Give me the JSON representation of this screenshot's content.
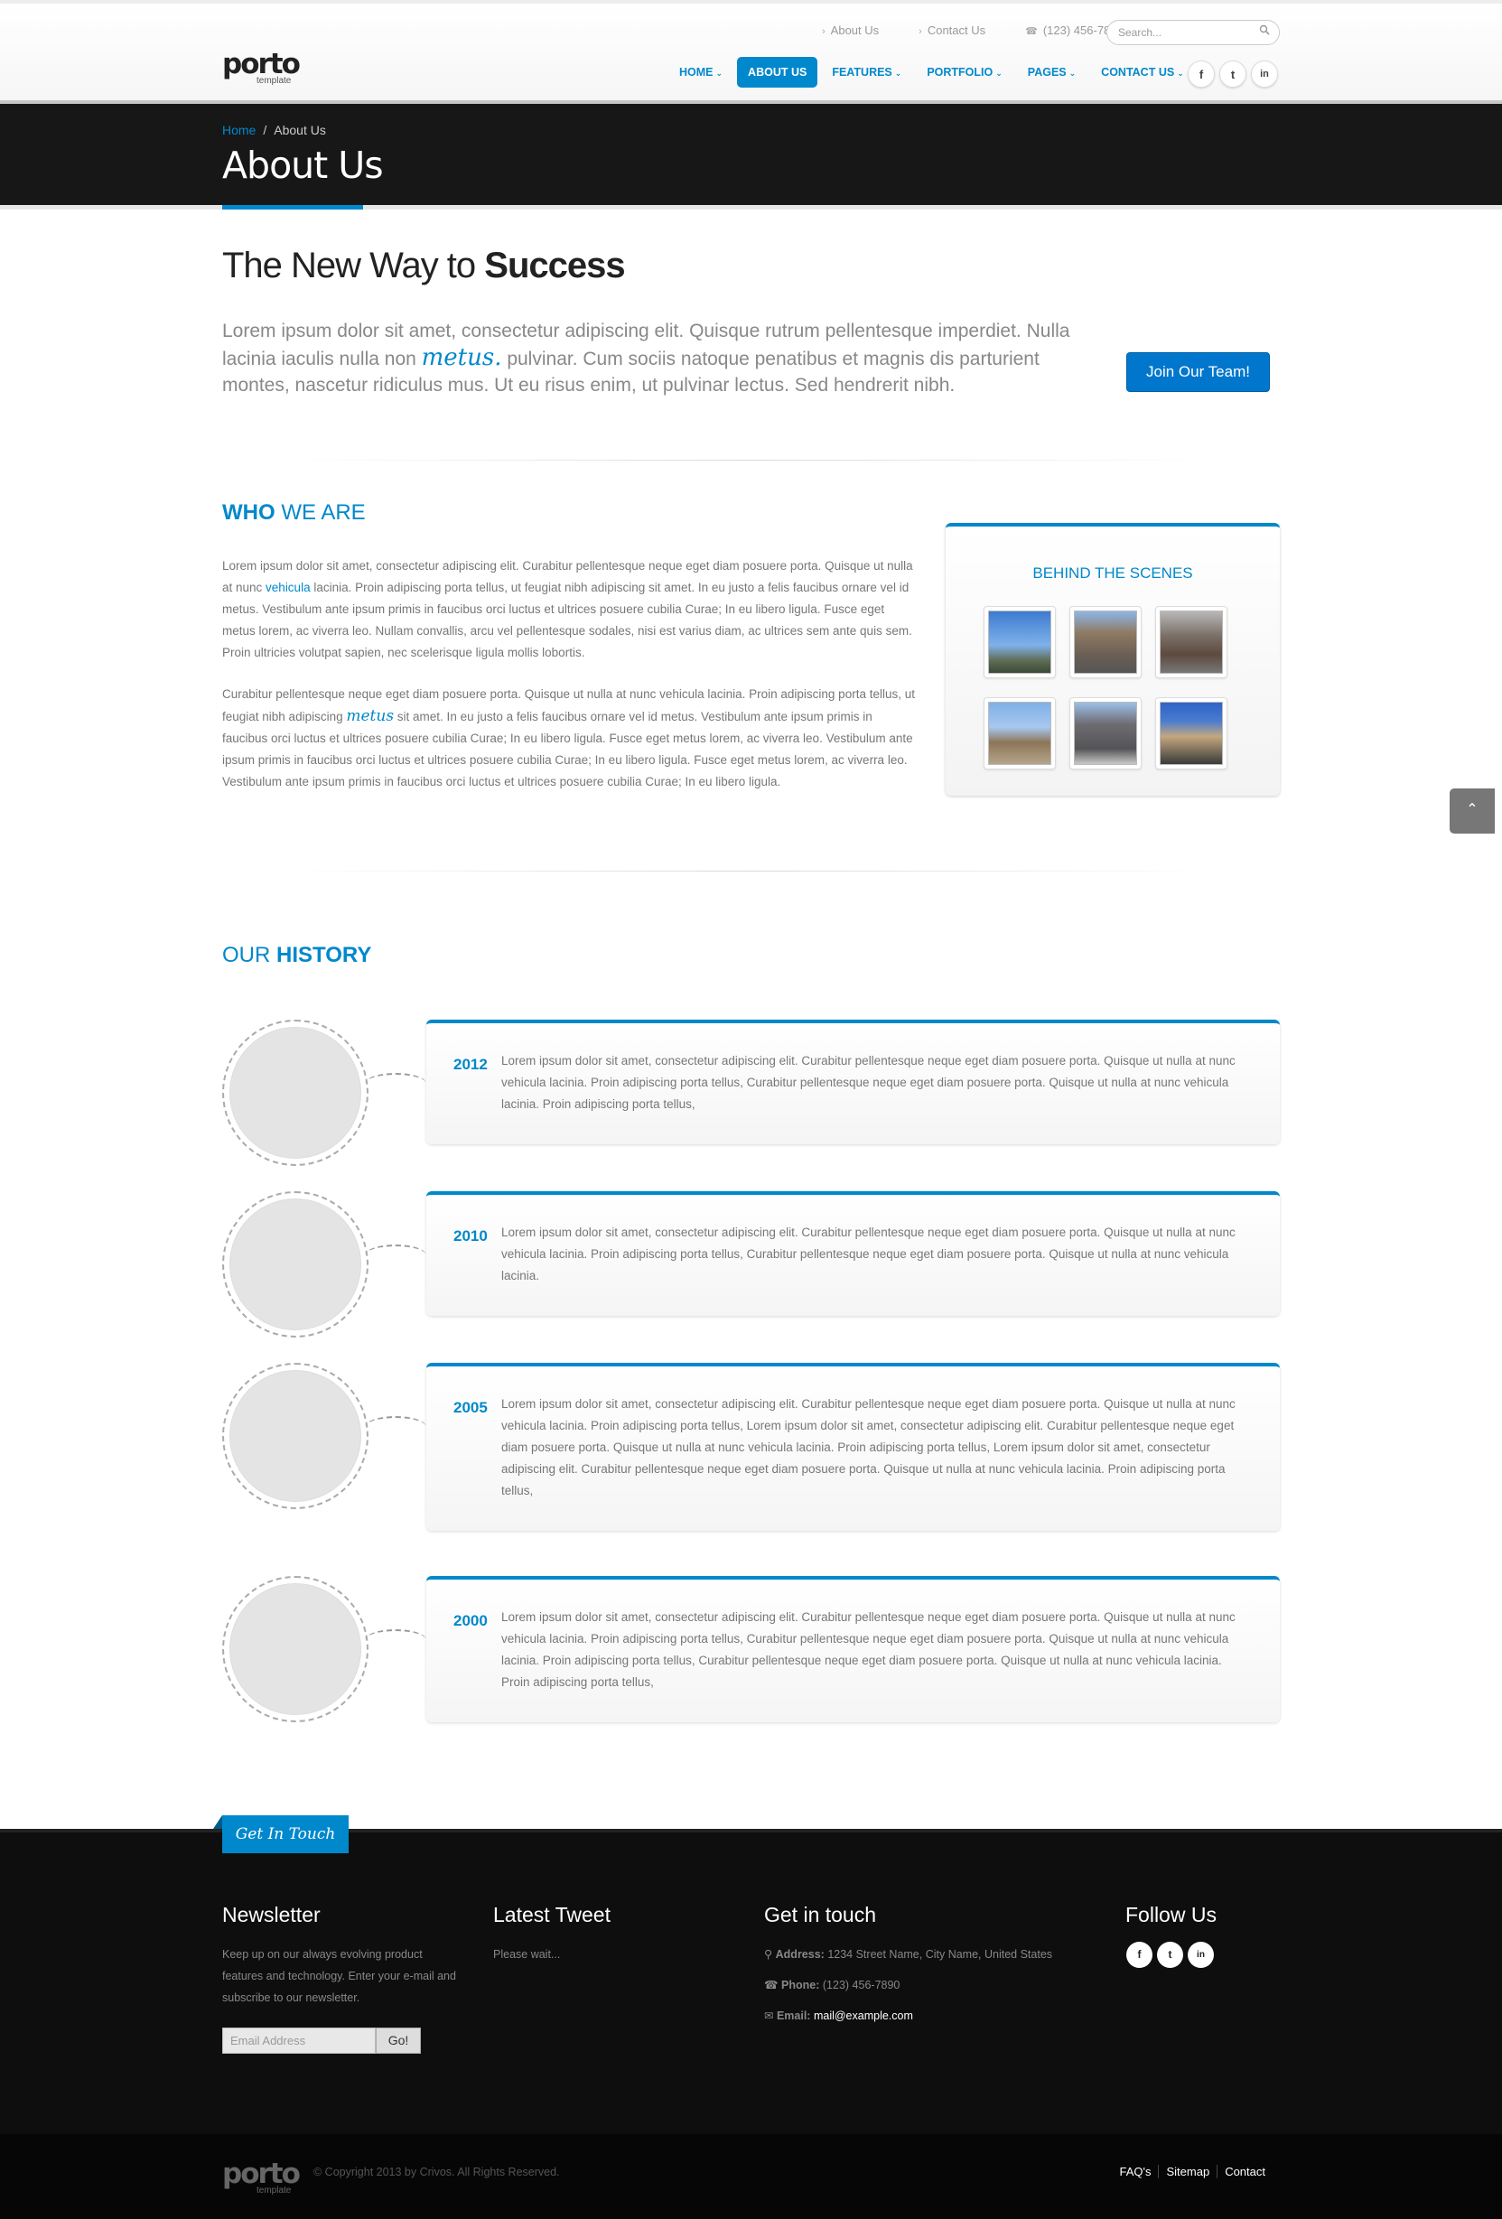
{
  "header": {
    "logo_word": "porto",
    "logo_sub": "template",
    "toplinks": [
      "About Us",
      "Contact Us"
    ],
    "phone": "(123) 456-7890",
    "search_placeholder": "Search...",
    "nav": [
      {
        "label": "HOME",
        "arrow": "⌄"
      },
      {
        "label": "ABOUT US",
        "arrow": ""
      },
      {
        "label": "FEATURES",
        "arrow": "⌄"
      },
      {
        "label": "PORTFOLIO",
        "arrow": "⌄"
      },
      {
        "label": "PAGES",
        "arrow": "⌄"
      },
      {
        "label": "CONTACT US",
        "arrow": "⌄"
      }
    ],
    "social": [
      "f",
      "t",
      "in"
    ]
  },
  "pagehead": {
    "crumb_home": "Home",
    "crumb_sep": "/",
    "crumb_current": "About Us",
    "title": "About Us"
  },
  "intro": {
    "title_light": "The New Way to ",
    "title_bold": "Success",
    "lead_a": "Lorem ipsum dolor sit amet, consectetur adipiscing elit. Quisque rutrum pellentesque imperdiet. Nulla lacinia iaculis nulla non ",
    "lead_metus": "metus.",
    "lead_b": " pulvinar. Cum sociis natoque penatibus et magnis dis parturient montes, nascetur ridiculus mus. Ut eu risus enim, ut pulvinar lectus. Sed hendrerit nibh.",
    "join_button": "Join Our Team!"
  },
  "who": {
    "title_bold": "WHO",
    "title_light": " WE ARE",
    "p1_a": "Lorem ipsum dolor sit amet, consectetur adipiscing elit. Curabitur pellentesque neque eget diam posuere porta. Quisque ut nulla at nunc ",
    "p1_link": "vehicula",
    "p1_b": " lacinia. Proin adipiscing porta tellus, ut feugiat nibh adipiscing sit amet. In eu justo a felis faucibus ornare vel id metus. Vestibulum ante ipsum primis in faucibus orci luctus et ultrices posuere cubilia Curae; In eu libero ligula. Fusce eget metus lorem, ac viverra leo. Nullam convallis, arcu vel pellentesque sodales, nisi est varius diam, ac ultrices sem ante quis sem. Proin ultricies volutpat sapien, nec scelerisque ligula mollis lobortis.",
    "p2_a": "Curabitur pellentesque neque eget diam posuere porta. Quisque ut nulla at nunc vehicula lacinia. Proin adipiscing porta tellus, ut feugiat nibh adipiscing ",
    "p2_metus": "metus",
    "p2_b": " sit amet. In eu justo a felis faucibus ornare vel id metus. Vestibulum ante ipsum primis in faucibus orci luctus et ultrices posuere cubilia Curae; In eu libero ligula. Fusce eget metus lorem, ac viverra leo. Vestibulum ante ipsum primis in faucibus orci luctus et ultrices posuere cubilia Curae; In eu libero ligula. Fusce eget metus lorem, ac viverra leo. Vestibulum ante ipsum primis in faucibus orci luctus et ultrices posuere cubilia Curae; In eu libero ligula.",
    "bts_title": "BEHIND THE SCENES"
  },
  "history": {
    "title_light": "OUR ",
    "title_bold": "HISTORY",
    "items": [
      {
        "year": "2012",
        "text": "Lorem ipsum dolor sit amet, consectetur adipiscing elit. Curabitur pellentesque neque eget diam posuere porta. Quisque ut nulla at nunc vehicula lacinia. Proin adipiscing porta tellus, Curabitur pellentesque neque eget diam posuere porta. Quisque ut nulla at nunc vehicula lacinia. Proin adipiscing porta tellus,"
      },
      {
        "year": "2010",
        "text": "Lorem ipsum dolor sit amet, consectetur adipiscing elit. Curabitur pellentesque neque eget diam posuere porta. Quisque ut nulla at nunc vehicula lacinia. Proin adipiscing porta tellus, Curabitur pellentesque neque eget diam posuere porta. Quisque ut nulla at nunc vehicula lacinia."
      },
      {
        "year": "2005",
        "text": "Lorem ipsum dolor sit amet, consectetur adipiscing elit. Curabitur pellentesque neque eget diam posuere porta. Quisque ut nulla at nunc vehicula lacinia. Proin adipiscing porta tellus, Lorem ipsum dolor sit amet, consectetur adipiscing elit. Curabitur pellentesque neque eget diam posuere porta. Quisque ut nulla at nunc vehicula lacinia. Proin adipiscing porta tellus, Lorem ipsum dolor sit amet, consectetur adipiscing elit. Curabitur pellentesque neque eget diam posuere porta. Quisque ut nulla at nunc vehicula lacinia. Proin adipiscing porta tellus,"
      },
      {
        "year": "2000",
        "text": "Lorem ipsum dolor sit amet, consectetur adipiscing elit. Curabitur pellentesque neque eget diam posuere porta. Quisque ut nulla at nunc vehicula lacinia. Proin adipiscing porta tellus, Curabitur pellentesque neque eget diam posuere porta. Quisque ut nulla at nunc vehicula lacinia. Proin adipiscing porta tellus, Curabitur pellentesque neque eget diam posuere porta. Quisque ut nulla at nunc vehicula lacinia. Proin adipiscing porta tellus,"
      }
    ]
  },
  "footer": {
    "ribbon": "Get In Touch",
    "newsletter_title": "Newsletter",
    "newsletter_text": "Keep up on our always evolving product features and technology. Enter your e-mail and subscribe to our newsletter.",
    "email_placeholder": "Email Address",
    "go_button": "Go!",
    "tweet_title": "Latest Tweet",
    "tweet_text": "Please wait...",
    "contact_title": "Get in touch",
    "address_label": "Address:",
    "address": "1234 Street Name, City Name, United States",
    "phone_label": "Phone:",
    "phone": "(123) 456-7890",
    "email_label": "Email:",
    "email": "mail@example.com",
    "follow_title": "Follow Us",
    "copyright": "© Copyright 2013 by Crivos. All Rights Reserved.",
    "links": [
      "FAQ's",
      "Sitemap",
      "Contact"
    ]
  },
  "colors": {
    "accent": "#0088cc",
    "dark": "#171717"
  }
}
